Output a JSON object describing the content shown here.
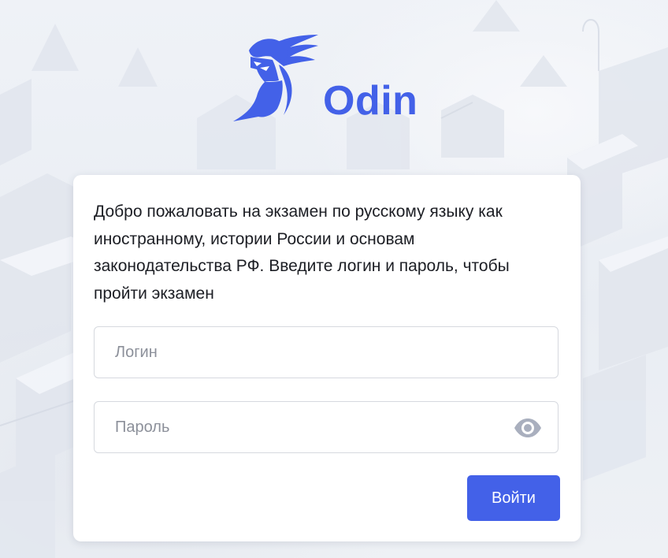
{
  "brand": {
    "name": "Odin",
    "logo_icon": "helmeted-warrior-logo-icon",
    "color": "#4361e8"
  },
  "login_card": {
    "welcome_text": "Добро пожаловать на экзамен по русскому языку как иностранному, истории России и основам законодательства РФ. Введите логин и пароль, чтобы пройти экзамен",
    "login_field": {
      "placeholder": "Логин",
      "value": ""
    },
    "password_field": {
      "placeholder": "Пароль",
      "value": "",
      "toggle_icon": "eye-icon"
    },
    "submit_label": "Войти"
  },
  "colors": {
    "accent": "#4361e8",
    "background": "#eef1f6",
    "card": "#ffffff",
    "text": "#1c1e24",
    "placeholder": "#8c909a",
    "eye_icon": "#a9afbe"
  }
}
